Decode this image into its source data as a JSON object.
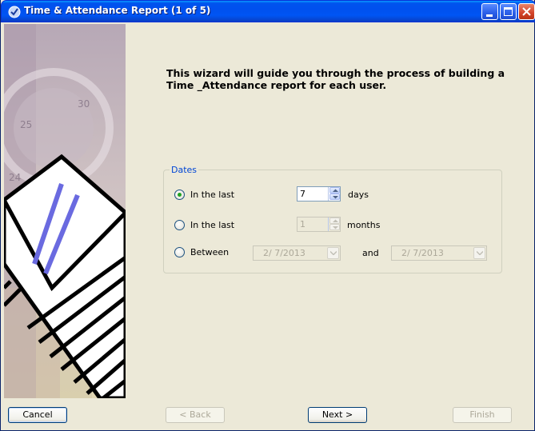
{
  "window": {
    "title": "Time & Attendance Report (1 of 5)",
    "icon": "checkmark-clock-icon",
    "controls": [
      "minimize-icon",
      "maximize-icon",
      "close-icon"
    ]
  },
  "intro": {
    "text": "This wizard will guide you through the process of building a Time _Attendance report for each user."
  },
  "dates_group": {
    "legend": "Dates",
    "option_last_days": {
      "label": "In the last",
      "checked": true,
      "value": "7",
      "unit": "days"
    },
    "option_last_months": {
      "label": "In the last",
      "checked": false,
      "value": "1",
      "unit": "months"
    },
    "option_between": {
      "label": "Between",
      "checked": false,
      "start": "2/ 7/2013",
      "and_label": "and",
      "end": "2/ 7/2013"
    }
  },
  "buttons": {
    "cancel": "Cancel",
    "back": "< Back",
    "next": "Next >",
    "finish": "Finish"
  },
  "colors": {
    "titlebar": "#0055ea",
    "accent_legend": "#0046d5",
    "window_bg": "#ece9d8"
  }
}
